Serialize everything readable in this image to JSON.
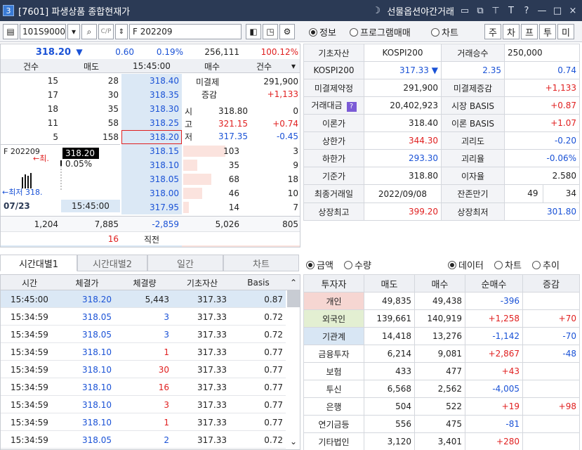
{
  "window": {
    "number": "3",
    "title": "[7601] 파생상품 종합현재가",
    "menu_label": "선물옵션야간거래"
  },
  "toolbar": {
    "code": "101S9000",
    "search_text": "F 202209",
    "radio_info": "정보",
    "radio_program": "프로그램매매",
    "radio_chart": "차트",
    "btn1": "주",
    "btn2": "차",
    "btn3": "프",
    "btn4": "투",
    "btn5": "미"
  },
  "quote": {
    "price": "318.20",
    "arrow": "▼",
    "change": "0.60",
    "rate": "0.19%",
    "volume": "256,111",
    "ratio": "100.12%"
  },
  "book": {
    "headers": [
      "건수",
      "매도",
      "15:45:00",
      "매수",
      "건수"
    ],
    "asks": [
      {
        "cnt": "15",
        "qty": "28",
        "price": "318.40"
      },
      {
        "cnt": "17",
        "qty": "30",
        "price": "318.35"
      },
      {
        "cnt": "18",
        "qty": "35",
        "price": "318.30"
      },
      {
        "cnt": "11",
        "qty": "58",
        "price": "318.25"
      },
      {
        "cnt": "5",
        "qty": "158",
        "price": "318.20"
      }
    ],
    "bids": [
      {
        "price": "318.15",
        "qty": "103",
        "cnt": "3"
      },
      {
        "price": "318.10",
        "qty": "35",
        "cnt": "9"
      },
      {
        "price": "318.05",
        "qty": "68",
        "cnt": "18"
      },
      {
        "price": "318.00",
        "qty": "46",
        "cnt": "10"
      },
      {
        "price": "317.95",
        "qty": "14",
        "cnt": "7"
      }
    ],
    "info": {
      "oi_label": "미결제",
      "oi_value": "291,900",
      "chg_label": "증감",
      "chg_value": "+1,133",
      "open_label": "시",
      "open_value": "318.80",
      "open_diff": "0",
      "high_label": "고",
      "high_value": "321.15",
      "high_diff": "+0.74",
      "low_label": "저",
      "low_value": "317.35",
      "low_diff": "-0.45"
    },
    "mini": {
      "name": "F 202209",
      "tag_price": "318.20",
      "tag_rate": "0.05%",
      "max_label": "←최.",
      "min_label": "←최저 318.",
      "date": "07/23",
      "time": "15:45:00"
    },
    "totals": {
      "cnt_ask": "1,204",
      "qty_ask": "7,885",
      "diff": "-2,859",
      "qty_bid": "5,026",
      "cnt_bid": "805",
      "last_qty": "16",
      "last_label": "직전"
    }
  },
  "tabs_left": [
    "시간대별1",
    "시간대별2",
    "일간",
    "차트"
  ],
  "ticks": {
    "headers": [
      "시간",
      "체결가",
      "체결량",
      "기초자산",
      "Basis"
    ],
    "rows": [
      {
        "time": "15:45:00",
        "price": "318.20",
        "qty": "5,443",
        "base": "317.33",
        "basis": "0.87",
        "qc": "black"
      },
      {
        "time": "15:34:59",
        "price": "318.05",
        "qty": "3",
        "base": "317.33",
        "basis": "0.72",
        "qc": "blue"
      },
      {
        "time": "15:34:59",
        "price": "318.05",
        "qty": "3",
        "base": "317.33",
        "basis": "0.72",
        "qc": "blue"
      },
      {
        "time": "15:34:59",
        "price": "318.10",
        "qty": "1",
        "base": "317.33",
        "basis": "0.77",
        "qc": "red"
      },
      {
        "time": "15:34:59",
        "price": "318.10",
        "qty": "30",
        "base": "317.33",
        "basis": "0.77",
        "qc": "red"
      },
      {
        "time": "15:34:59",
        "price": "318.10",
        "qty": "16",
        "base": "317.33",
        "basis": "0.77",
        "qc": "red"
      },
      {
        "time": "15:34:59",
        "price": "318.10",
        "qty": "3",
        "base": "317.33",
        "basis": "0.77",
        "qc": "red"
      },
      {
        "time": "15:34:59",
        "price": "318.10",
        "qty": "1",
        "base": "317.33",
        "basis": "0.77",
        "qc": "red"
      },
      {
        "time": "15:34:59",
        "price": "318.05",
        "qty": "2",
        "base": "317.33",
        "basis": "0.72",
        "qc": "blue"
      }
    ]
  },
  "info_panel": {
    "r1": {
      "l1": "기초자산",
      "v1": "KOSPI200",
      "l2": "거래승수",
      "v2": "250,000"
    },
    "r2": {
      "l1": "KOSPI200",
      "v1": "317.33",
      "arrow": "▼",
      "v2": "2.35",
      "v3": "0.74"
    },
    "rows": [
      {
        "l1": "미결제약정",
        "v1": "291,900",
        "c1": "black",
        "l2": "미결제증감",
        "v2": "+1,133",
        "c2": "red"
      },
      {
        "l1": "거래대금",
        "v1": "20,402,923",
        "c1": "black",
        "l2": "시장 BASIS",
        "v2": "+0.87",
        "c2": "red"
      },
      {
        "l1": "이론가",
        "v1": "318.40",
        "c1": "black",
        "l2": "이론 BASIS",
        "v2": "+1.07",
        "c2": "red"
      },
      {
        "l1": "상한가",
        "v1": "344.30",
        "c1": "red",
        "l2": "괴리도",
        "v2": "-0.20",
        "c2": "blue"
      },
      {
        "l1": "하한가",
        "v1": "293.30",
        "c1": "blue",
        "l2": "괴리율",
        "v2": "-0.06%",
        "c2": "blue"
      },
      {
        "l1": "기준가",
        "v1": "318.80",
        "c1": "black",
        "l2": "이자율",
        "v2": "2.580",
        "c2": "black"
      }
    ],
    "r9": {
      "l1": "최종거래일",
      "v1": "2022/09/08",
      "l2": "잔존만기",
      "v2": "49",
      "v3": "34"
    },
    "r10": {
      "l1": "상장최고",
      "v1": "399.20",
      "l2": "상장최저",
      "v2": "301.80"
    },
    "help_icon": "?"
  },
  "investor_options": {
    "amount": "금액",
    "quantity": "수량",
    "data": "데이터",
    "chart": "차트",
    "trend": "추이"
  },
  "investors": {
    "headers": [
      "투자자",
      "매도",
      "매수",
      "순매수",
      "증감"
    ],
    "rows": [
      {
        "name": "개인",
        "sell": "49,835",
        "buy": "49,438",
        "net": "-396",
        "chg": "",
        "nc": "blue",
        "cc": "black",
        "bg": "#f6d6d2"
      },
      {
        "name": "외국인",
        "sell": "139,661",
        "buy": "140,919",
        "net": "+1,258",
        "chg": "+70",
        "nc": "red",
        "cc": "red",
        "bg": "#e3efd2"
      },
      {
        "name": "기관계",
        "sell": "14,418",
        "buy": "13,276",
        "net": "-1,142",
        "chg": "-70",
        "nc": "blue",
        "cc": "blue",
        "bg": "#d8e6f4"
      },
      {
        "name": "금융투자",
        "sell": "6,214",
        "buy": "9,081",
        "net": "+2,867",
        "chg": "-48",
        "nc": "red",
        "cc": "blue",
        "bg": "#fff"
      },
      {
        "name": "보험",
        "sell": "433",
        "buy": "477",
        "net": "+43",
        "chg": "",
        "nc": "red",
        "cc": "black",
        "bg": "#fff"
      },
      {
        "name": "투신",
        "sell": "6,568",
        "buy": "2,562",
        "net": "-4,005",
        "chg": "",
        "nc": "blue",
        "cc": "black",
        "bg": "#fff"
      },
      {
        "name": "은행",
        "sell": "504",
        "buy": "522",
        "net": "+19",
        "chg": "+98",
        "nc": "red",
        "cc": "red",
        "bg": "#fff"
      },
      {
        "name": "연기금등",
        "sell": "556",
        "buy": "475",
        "net": "-81",
        "chg": "",
        "nc": "blue",
        "cc": "black",
        "bg": "#fff"
      },
      {
        "name": "기타법인",
        "sell": "3,120",
        "buy": "3,401",
        "net": "+280",
        "chg": "",
        "nc": "red",
        "cc": "black",
        "bg": "#fff"
      }
    ]
  },
  "colors": {
    "ask_bg": "#dbe8f5",
    "bid_bg": "#fbe3de",
    "accent": "#1a52d6",
    "up": "#e02020"
  }
}
